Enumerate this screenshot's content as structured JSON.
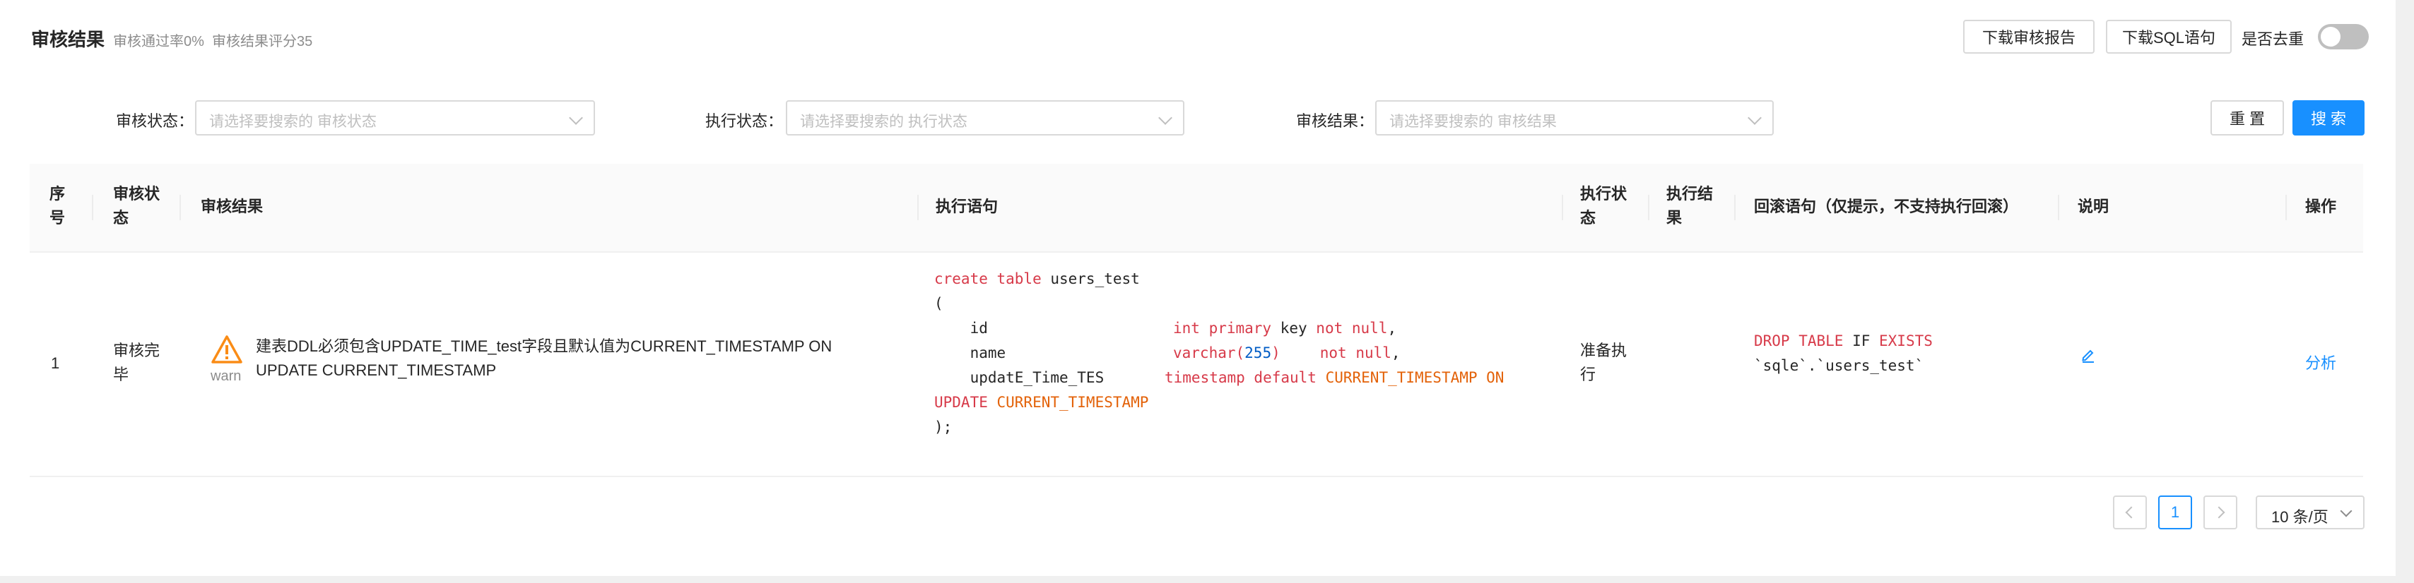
{
  "header": {
    "title": "审核结果",
    "pass_rate": "审核通过率0%",
    "score": "审核结果评分35",
    "download_report": "下载审核报告",
    "download_sql": "下载SQL语句",
    "dedupe_label": "是否去重",
    "dedupe_on": false
  },
  "filters": {
    "audit_status_label": "审核状态",
    "audit_status_placeholder": "请选择要搜索的 审核状态",
    "exec_status_label": "执行状态",
    "exec_status_placeholder": "请选择要搜索的 执行状态",
    "audit_result_label": "审核结果",
    "audit_result_placeholder": "请选择要搜索的 审核结果",
    "reset": "重 置",
    "search": "搜 索"
  },
  "table": {
    "columns": {
      "index": "序号",
      "audit_status": "审核状态",
      "audit_result": "审核结果",
      "exec_sql": "执行语句",
      "exec_status": "执行状态",
      "exec_result": "执行结果",
      "rollback": "回滚语句（仅提示，不支持执行回滚）",
      "desc": "说明",
      "action": "操作"
    },
    "rows": [
      {
        "index": "1",
        "audit_status": "审核完毕",
        "level": "warn",
        "audit_result": "建表DDL必须包含UPDATE_TIME_test字段且默认值为CURRENT_TIMESTAMP ON UPDATE CURRENT_TIMESTAMP",
        "exec_status": "准备执行",
        "exec_result": "",
        "action": "分析",
        "sql": {
          "l1a": "create table",
          "l1b": " users_test",
          "l2": "(",
          "l3a": "    id",
          "l3b": "int primary",
          "l3c": " key ",
          "l3d": "not null",
          "l3e": ",",
          "l4a": "    name",
          "l4b": "varchar(",
          "l4c": "255",
          "l4d": ")",
          "l4e": "not null",
          "l4f": ",",
          "l5a": "    updatE_Time_TES",
          "l5b": "timestamp default",
          "l5c": " CURRENT_TIMESTAMP ON",
          "l6a": "UPDATE",
          "l6b": " CURRENT_TIMESTAMP",
          "l7": ");"
        },
        "rollback": {
          "a": "DROP TABLE",
          "b": " IF ",
          "c": "EXISTS",
          "d": "`sqle`.`users_test`"
        }
      }
    ]
  },
  "pagination": {
    "current": "1",
    "page_size": "10 条/页"
  }
}
